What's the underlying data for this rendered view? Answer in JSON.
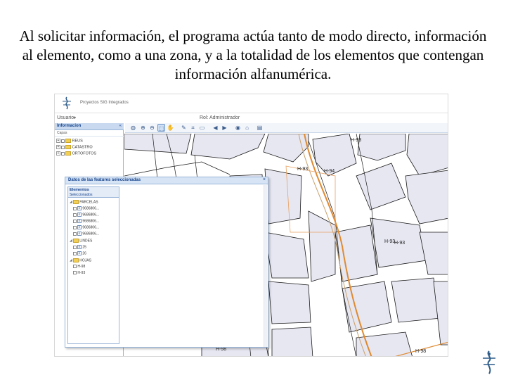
{
  "caption": "Al solicitar información, el programa actúa tanto de modo directo, información al elemento, como a una zona, y a la totalidad de los elementos que contengan información alfanumérica.",
  "app": {
    "title": "Proyectos SIG Integrados",
    "user_label": "Usuario:",
    "user_caret": "▾",
    "rol_label": "Rol: Administrador"
  },
  "left_panel": {
    "header": "Informacion",
    "collapse": "«",
    "layers_label": "Capas",
    "layers": [
      "REUS",
      "CATASTRO",
      "ORTOFOTOS"
    ]
  },
  "toolbar": {
    "icons": [
      "globe-icon",
      "zoom-in-icon",
      "zoom-out-icon",
      "select-area-icon",
      "pan-icon",
      "draw-line-icon",
      "measure-icon",
      "erase-icon",
      "back-icon",
      "forward-icon",
      "binoculars-icon",
      "home-icon",
      "print-icon"
    ]
  },
  "dialog": {
    "title": "Datos de las features seleccionadas",
    "close": "×",
    "tree_header_1": "Elementos",
    "tree_header_2": "Seleccionados",
    "groups": [
      {
        "label": "PARCELAS",
        "items": [
          "9686806...",
          "9686806...",
          "9686806...",
          "9686806...",
          "9686806..."
        ]
      },
      {
        "label": "LINDES",
        "items": [
          "25",
          "26"
        ]
      },
      {
        "label": "HOJAS",
        "items": [
          "H-98",
          "H-93"
        ]
      }
    ]
  },
  "map": {
    "labels": [
      "H-93",
      "H-93",
      "H-94",
      "H-93",
      "H-93",
      "H-98",
      "H-98"
    ]
  },
  "colors": {
    "parcel_fill": "#e7e7f2",
    "parcel_stroke": "#1a1a1a",
    "road": "#e08a30",
    "highlight": "#c9a06a",
    "panel_header": "#c9daf0"
  }
}
